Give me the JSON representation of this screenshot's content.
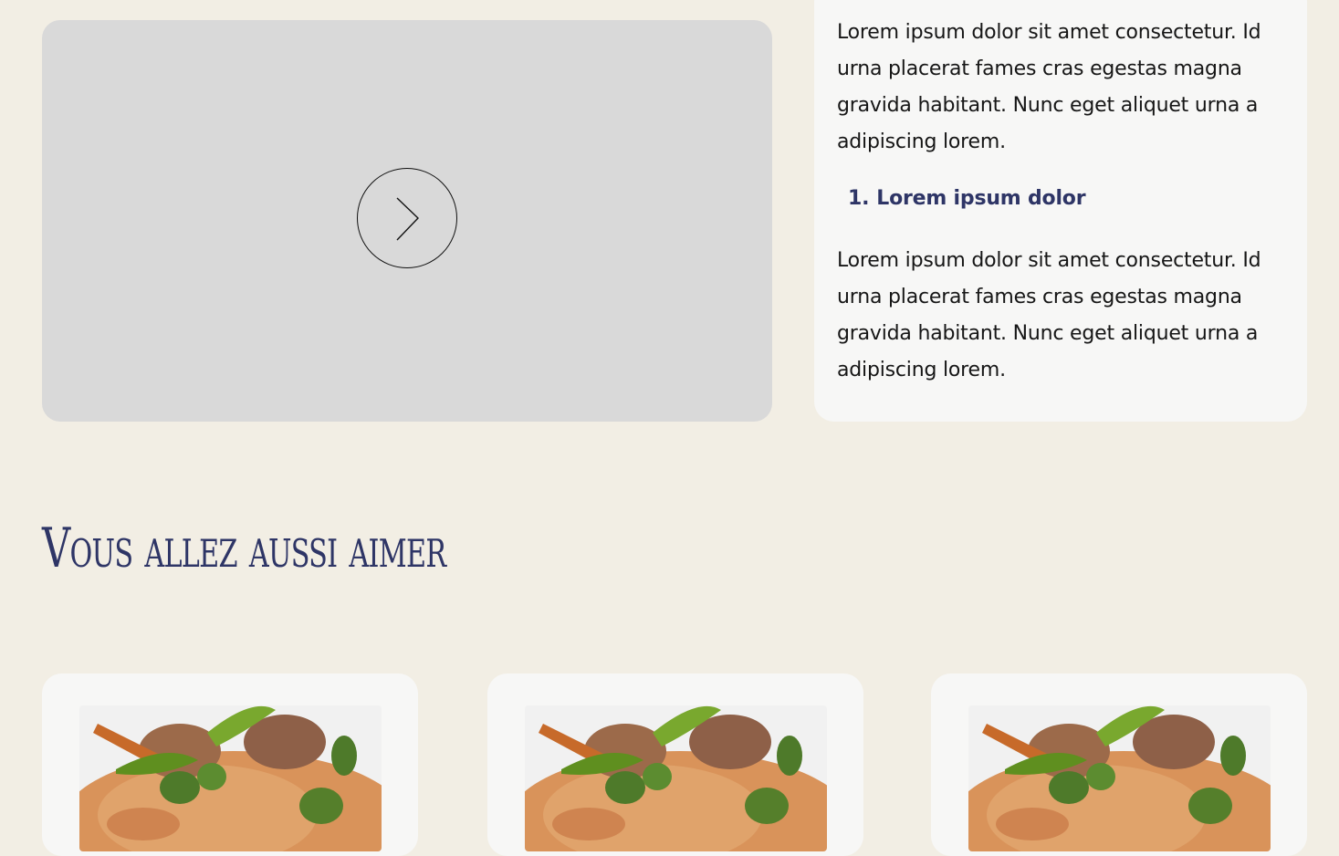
{
  "description_card": {
    "paragraph_1": "Lorem ipsum dolor sit amet consectetur. Id urna placerat fames cras egestas magna gravida habitant. Nunc eget aliquet urna a adipiscing lorem.",
    "list_item_number": "1.",
    "list_item_text": "Lorem ipsum dolor",
    "paragraph_2": "Lorem ipsum dolor sit amet consectetur. Id urna placerat fames cras egestas magna gravida habitant. Nunc eget aliquet urna a adipiscing lorem."
  },
  "video": {
    "play_icon": "play-chevron-icon"
  },
  "recommendations": {
    "title": "Vous allez aussi aimer",
    "cards": [
      {
        "image": "rice-dish-image"
      },
      {
        "image": "rice-dish-image"
      },
      {
        "image": "rice-dish-image"
      }
    ]
  },
  "colors": {
    "background": "#f2eee4",
    "card": "#f7f7f6",
    "video_placeholder": "#d9d9d9",
    "accent_navy": "#2e3566"
  }
}
